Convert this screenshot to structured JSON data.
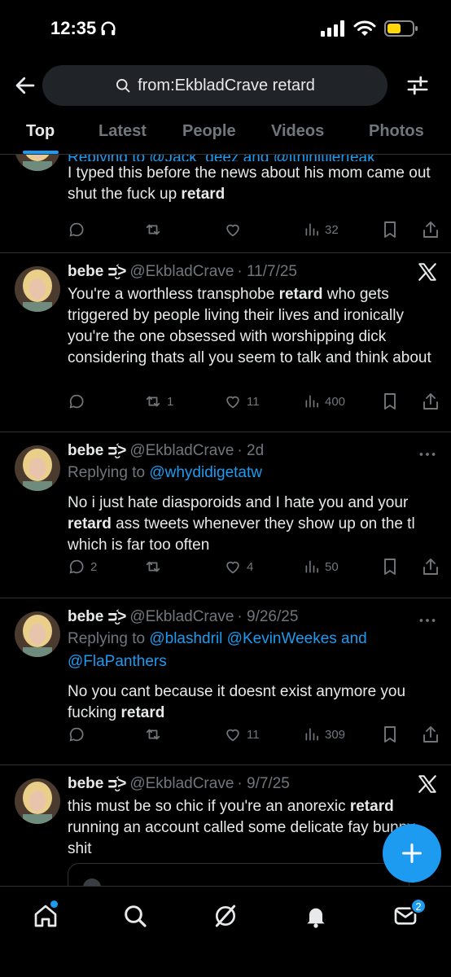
{
  "status_bar": {
    "time": "12:35"
  },
  "search": {
    "query": "from:EkbladCrave retard"
  },
  "tabs": [
    "Top",
    "Latest",
    "People",
    "Videos",
    "Photos"
  ],
  "tweets": [
    {
      "text_parts": [
        "I typed this before the news about his mom came out shut the fuck up ",
        "retard",
        ""
      ],
      "replying_to_partial": "Replying to @Jack_deez and @ithinitllerfeak",
      "stats": {
        "replies": "",
        "reposts": "",
        "likes": "",
        "views": "32"
      }
    },
    {
      "display_name": "bebe ᴝ̮᷾˃",
      "handle": "@EkbladCrave",
      "time": "· 11/7/25",
      "text_parts": [
        "You're a worthless transphobe ",
        "retard",
        " who gets triggered by people living their lives and ironically you're the one obsessed with worshipping dick considering thats all you seem to talk and think about"
      ],
      "stats": {
        "replies": "",
        "reposts": "1",
        "likes": "11",
        "views": "400"
      }
    },
    {
      "display_name": "bebe ᴝ̮᷾˃",
      "handle": "@EkbladCrave",
      "time": "· 2d",
      "replying_label": "Replying to",
      "replying_to": "@whydidigetatw",
      "text_parts": [
        "No i just hate diasporoids and I hate you and your ",
        "retard",
        " ass tweets whenever they show up on the tl which is far too often"
      ],
      "stats": {
        "replies": "2",
        "reposts": "",
        "likes": "4",
        "views": "50"
      }
    },
    {
      "display_name": "bebe ᴝ̮᷾˃",
      "handle": "@EkbladCrave",
      "time": "· 9/26/25",
      "replying_label": "Replying to",
      "replying_to": "@blashdril @KevinWeekes and",
      "replying_to_2": "@FlaPanthers",
      "text_parts": [
        "No you cant because it doesnt exist anymore you fucking ",
        "retard",
        ""
      ],
      "stats": {
        "replies": "",
        "reposts": "",
        "likes": "11",
        "views": "309"
      }
    },
    {
      "display_name": "bebe ᴝ̮᷾˃",
      "handle": "@EkbladCrave",
      "time": "· 9/7/25",
      "text_parts": [
        "this must be so chic if you're an anorexic ",
        "retard",
        " running an account called some delicate fay bunny shit"
      ]
    }
  ],
  "bottom_nav": {
    "messages_badge": "2"
  },
  "colors": {
    "accent": "#1d9bf0",
    "muted": "#71767b",
    "text": "#e7e9ea",
    "divider": "#2f3336"
  }
}
